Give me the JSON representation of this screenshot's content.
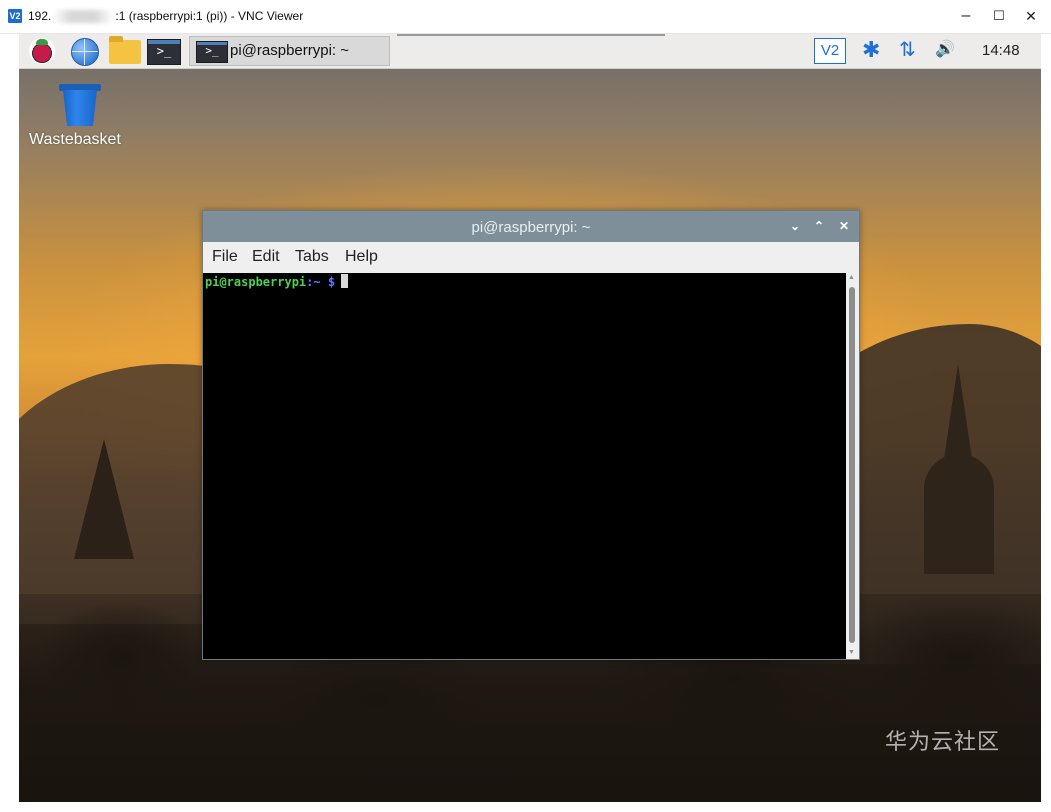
{
  "vnc": {
    "title_prefix": "192.",
    "title_suffix": ":1 (raspberrypi:1 (pi)) - VNC Viewer",
    "logo": "V2",
    "minimize": "–",
    "maximize": "☐",
    "close": "✕"
  },
  "taskbar": {
    "task_label": "pi@raspberrypi: ~",
    "launcher_glyph": ">_",
    "vnc_tray_label": "V2",
    "bluetooth_glyph": "✱",
    "network_glyph": "⇅",
    "volume_glyph": "🔊",
    "clock": "14:48",
    "icons": [
      "raspberry-pi-menu-icon",
      "web-browser-icon",
      "file-manager-icon",
      "terminal-icon"
    ]
  },
  "desktop": {
    "wastebasket_label": "Wastebasket"
  },
  "terminal": {
    "title": "pi@raspberrypi: ~",
    "menu": [
      "File",
      "Edit",
      "Tabs",
      "Help"
    ],
    "prompt_user": "pi@raspberrypi",
    "prompt_path": ":~ $",
    "controls": {
      "minimize": "⌄",
      "maximize": "⌃",
      "close": "✕"
    }
  },
  "watermark": "华为云社区",
  "colors": {
    "accent": "#1e6fd6",
    "terminal_bg": "#000000",
    "prompt_user": "#4fd14f",
    "prompt_path": "#5c7cff",
    "titlebar": "#7f8f99"
  }
}
